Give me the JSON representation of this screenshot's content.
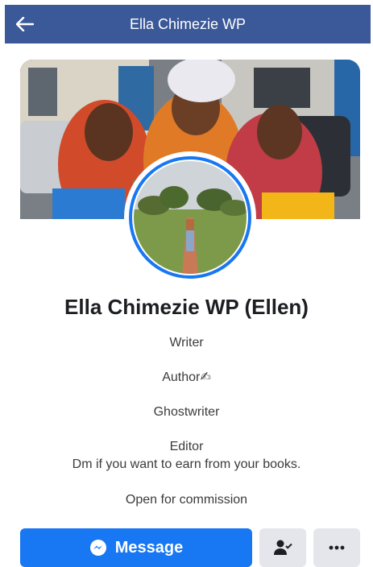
{
  "header": {
    "title": "Ella Chimezie WP",
    "back_icon": "arrow-left-icon",
    "bg_color": "#3b5998"
  },
  "profile": {
    "name": "Ella Chimezie WP (Ellen)",
    "bio": [
      "Writer",
      "Author✍",
      "Ghostwriter",
      "Editor",
      "Dm if you want to earn from your books.",
      "Open for commission"
    ]
  },
  "actions": {
    "message_label": "Message",
    "message_icon": "messenger-icon",
    "friends_icon": "person-check-icon",
    "more_icon": "more-horizontal-icon",
    "accent": "#1877f2"
  }
}
